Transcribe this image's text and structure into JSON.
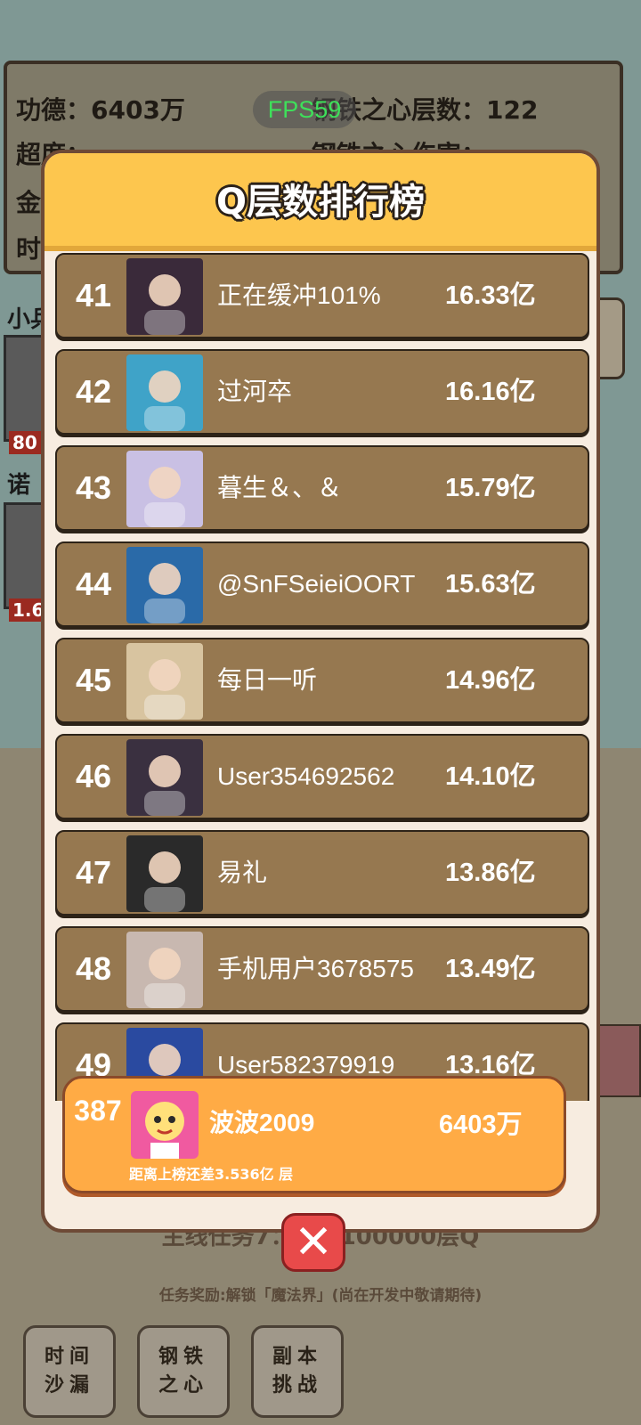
{
  "hud": {
    "merit": "功德：6403万",
    "steel_layers": "钢铁之心层数：122",
    "fps": "FPS59",
    "partial_left_1": "超度：",
    "partial_left_2": "金",
    "partial_left_3": "时",
    "partial_right": "钢铁之心伤害："
  },
  "side": {
    "label_1": "小兵",
    "tag_1": "80",
    "label_2": "诺",
    "tag_2": "1.6"
  },
  "mission": {
    "line1": "主线任务7：通过100000层Q",
    "line2": "任务奖励:解锁「魔法界」(尚在开发中敬请期待)"
  },
  "bottom_buttons": [
    {
      "label": "时间\n沙漏"
    },
    {
      "label": "钢铁\n之心"
    },
    {
      "label": "副本\n挑战"
    }
  ],
  "leaderboard": {
    "title": "Q层数排行榜",
    "rows": [
      {
        "rank": "41",
        "name": "正在缓冲101%",
        "score": "16.33亿",
        "avatar": "anime-girl-avatar",
        "color": "#3a2a3a"
      },
      {
        "rank": "42",
        "name": "过河卒",
        "score": "16.16亿",
        "avatar": "king-avatar",
        "color": "#3fa3c8"
      },
      {
        "rank": "43",
        "name": "暮生＆、＆",
        "score": "15.79亿",
        "avatar": "silver-hair-avatar",
        "color": "#c9c0e4"
      },
      {
        "rank": "44",
        "name": "@SnFSeieiOORT",
        "score": "15.63亿",
        "avatar": "hero-avatar",
        "color": "#2a6aa8"
      },
      {
        "rank": "45",
        "name": "每日一听",
        "score": "14.96亿",
        "avatar": "shiba-avatar",
        "color": "#d8c4a0"
      },
      {
        "rank": "46",
        "name": "User354692562",
        "score": "14.10亿",
        "avatar": "doll-avatar",
        "color": "#3a3040"
      },
      {
        "rank": "47",
        "name": "易礼",
        "score": "13.86亿",
        "avatar": "white-hair-avatar",
        "color": "#2a2a2a"
      },
      {
        "rank": "48",
        "name": "手机用户3678575",
        "score": "13.49亿",
        "avatar": "man-avatar",
        "color": "#c8b8b0"
      },
      {
        "rank": "49",
        "name": "User582379919",
        "score": "13.16亿",
        "avatar": "robot-avatar",
        "color": "#2a4aa0"
      }
    ],
    "self": {
      "rank": "387",
      "name": "波波2009",
      "score": "6403万",
      "gap": "距离上榜还差3.536亿 层",
      "avatar": "cartoon-avatar"
    }
  },
  "colors": {
    "header": "#fdc64e",
    "row_bg": "#967850",
    "self_bg": "#ffab45",
    "close": "#e84a4a"
  }
}
